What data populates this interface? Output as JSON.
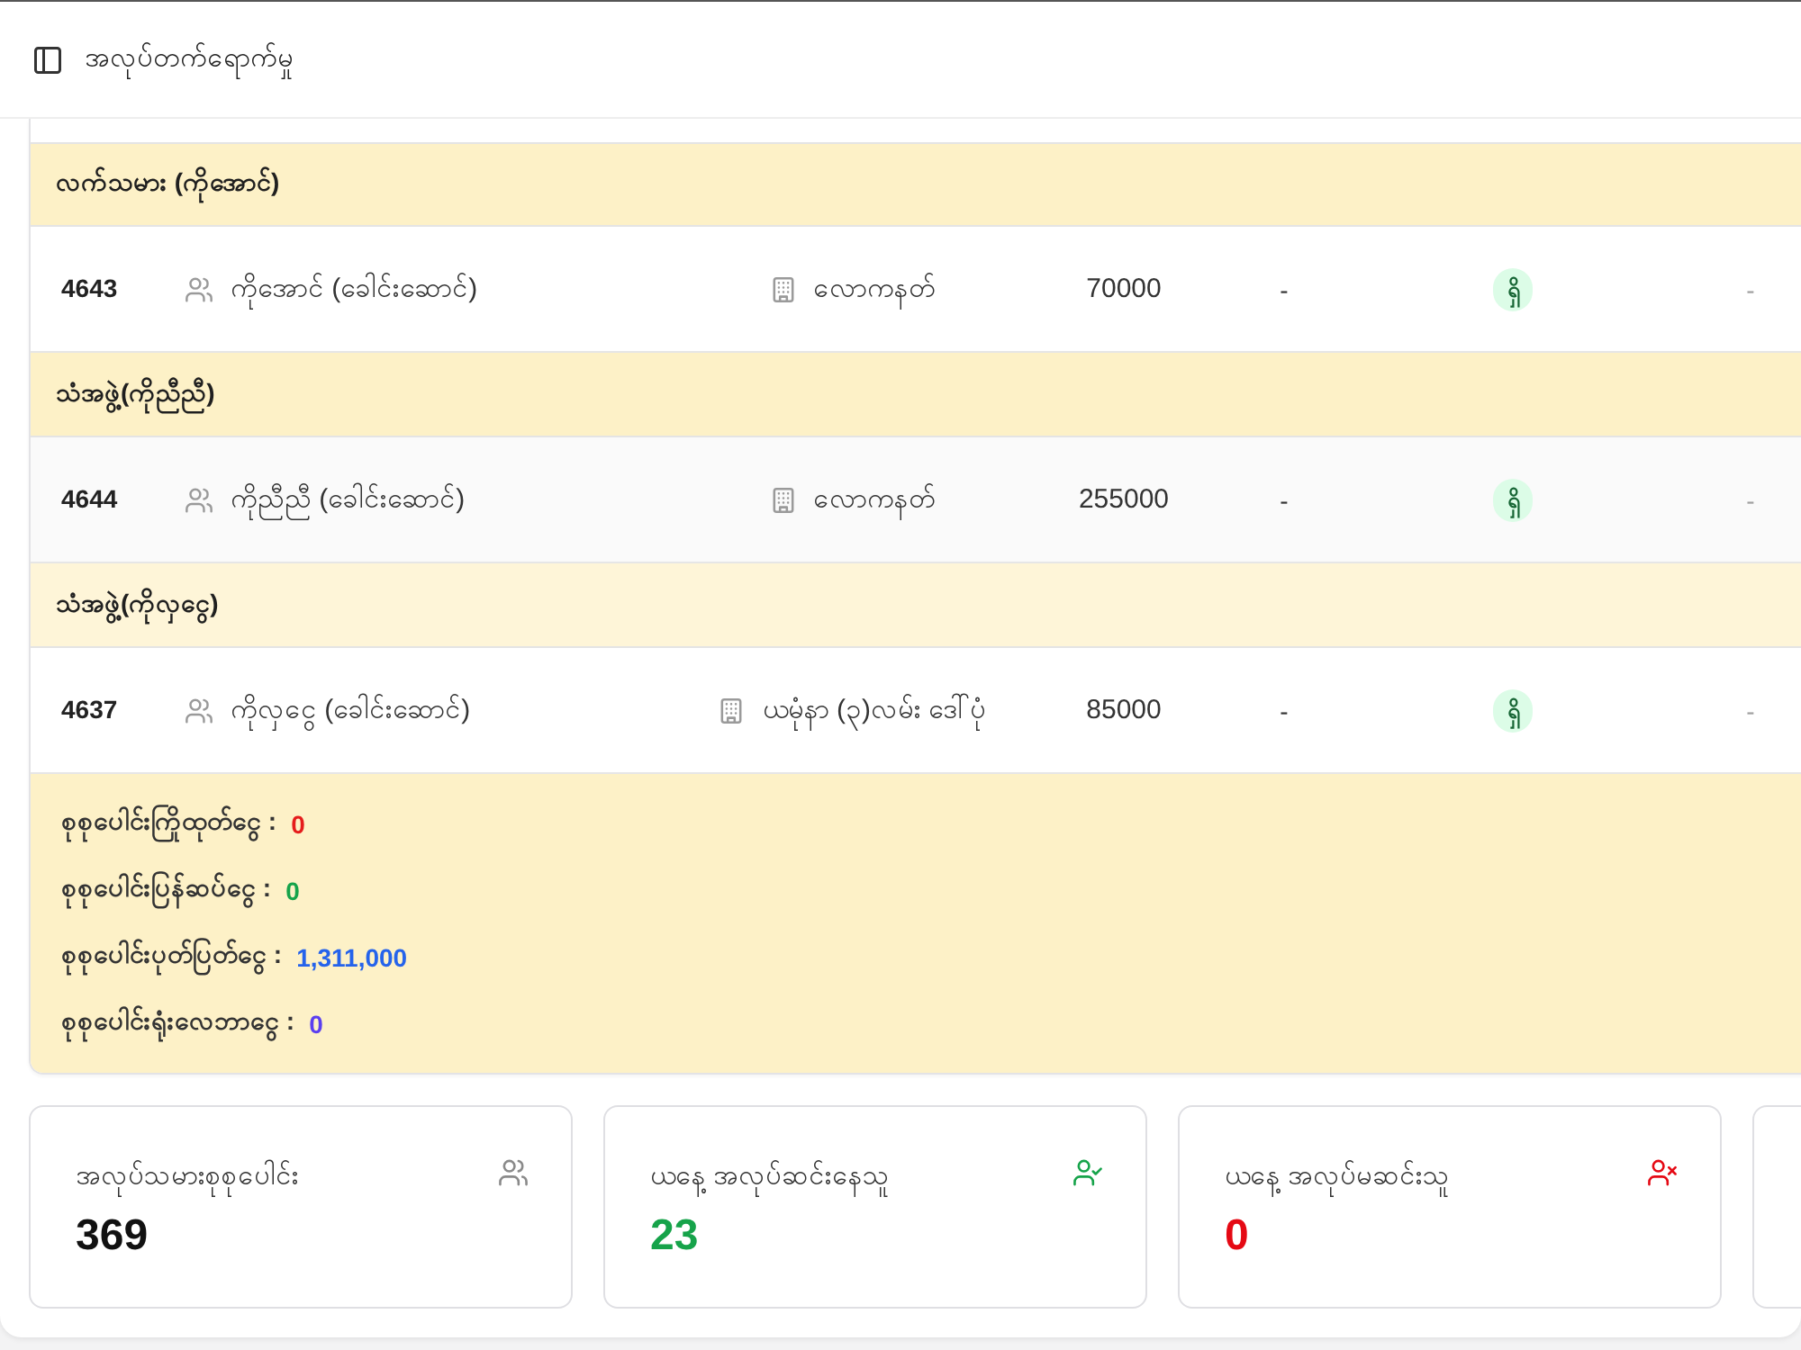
{
  "header": {
    "title": "အလုပ်တက်ရောက်မှု"
  },
  "groups": [
    {
      "title": "လက်သမား (ကိုအောင်)",
      "dimmed": false,
      "rows": [
        {
          "number": "4643",
          "name": "ကိုအောင် (ခေါင်းဆောင်)",
          "location": "လောကနတ်",
          "amount": "70000",
          "column_5": "-",
          "status": "ရှိ",
          "column_7": "-"
        }
      ]
    },
    {
      "title": "သံအဖွဲ့(ကိုညီညီ)",
      "dimmed": false,
      "rows": [
        {
          "number": "4644",
          "name": "ကိုညီညီ (ခေါင်းဆောင်)",
          "location": "လောကနတ်",
          "amount": "255000",
          "column_5": "-",
          "status": "ရှိ",
          "column_7": "-"
        }
      ]
    },
    {
      "title": "သံအဖွဲ့(ကိုလှငွေ)",
      "dimmed": true,
      "rows": [
        {
          "number": "4637",
          "name": "ကိုလှငွေ (ခေါင်းဆောင်)",
          "location": "ယမုံနာ (၃)လမ်း ဒေါ်ပုံ",
          "amount": "85000",
          "column_5": "-",
          "status": "ရှိ",
          "column_7": "-"
        }
      ]
    }
  ],
  "totals": [
    {
      "label": "စုစုပေါင်းကြိုထုတ်ငွေ :",
      "value": "0",
      "color": "#e51c1c"
    },
    {
      "label": "စုစုပေါင်းပြန်ဆပ်ငွေ :",
      "value": "0",
      "color": "#16a34a"
    },
    {
      "label": "စုစုပေါင်းပုတ်ပြတ်ငွေ :",
      "value": "1,311,000",
      "color": "#2563eb"
    },
    {
      "label": "စုစုပေါင်းရုံးလေဘာငွေ :",
      "value": "0",
      "color": "#5b3ff0"
    }
  ],
  "cards": [
    {
      "kind": "all",
      "title": "အလုပ်သမားစုစုပေါင်း",
      "value": "369",
      "color": "#111111"
    },
    {
      "kind": "present",
      "title": "ယနေ့ အလုပ်ဆင်းနေသူ",
      "value": "23",
      "color": "#16a34a"
    },
    {
      "kind": "absent",
      "title": "ယနေ့ အလုပ်မဆင်းသူ",
      "value": "0",
      "color": "#e50914"
    }
  ]
}
